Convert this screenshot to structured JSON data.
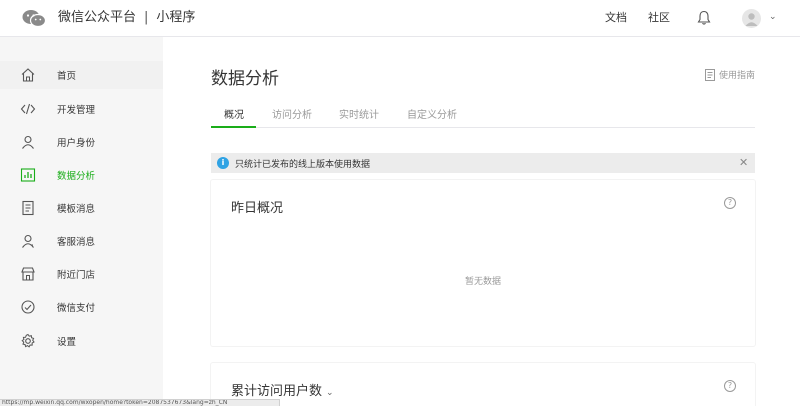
{
  "header": {
    "brand": "微信公众平台",
    "separator": "|",
    "product": "小程序",
    "nav": [
      "文档",
      "社区"
    ]
  },
  "sidebar": {
    "items": [
      {
        "label": "首页",
        "icon": "home-icon"
      },
      {
        "label": "开发管理",
        "icon": "code-icon"
      },
      {
        "label": "用户身份",
        "icon": "user-icon"
      },
      {
        "label": "数据分析",
        "icon": "chart-icon"
      },
      {
        "label": "模板消息",
        "icon": "document-icon"
      },
      {
        "label": "客服消息",
        "icon": "support-icon"
      },
      {
        "label": "附近门店",
        "icon": "store-icon"
      },
      {
        "label": "微信支付",
        "icon": "pay-icon"
      },
      {
        "label": "设置",
        "icon": "gear-icon"
      }
    ]
  },
  "main": {
    "title": "数据分析",
    "guide": "使用指南",
    "tabs": [
      "概况",
      "访问分析",
      "实时统计",
      "自定义分析"
    ],
    "notice": "只统计已发布的线上版本使用数据",
    "cards": [
      {
        "title": "昨日概况",
        "empty": "暂无数据"
      },
      {
        "title": "累计访问用户数"
      }
    ]
  },
  "status_bar": {
    "url": "https://mp.weixin.qq.com/wxopen/home?token=2087537673&lang=zh_CN"
  },
  "colors": {
    "accent": "#1aad19",
    "info": "#30a3e4"
  }
}
